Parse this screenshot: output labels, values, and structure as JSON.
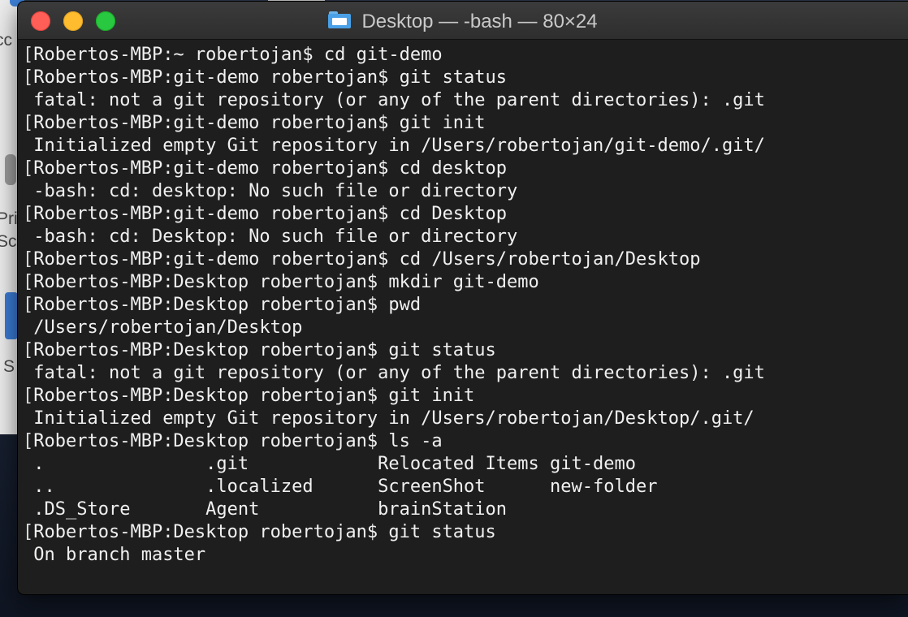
{
  "background": {
    "fragments": [
      "cc",
      "Pri",
      "Sc",
      "S"
    ]
  },
  "window": {
    "title": "Desktop — -bash — 80×24",
    "title_icon": "folder-icon"
  },
  "terminal": {
    "lines": [
      {
        "type": "prompt",
        "text": "Robertos-MBP:~ robertojan$ cd git-demo"
      },
      {
        "type": "prompt",
        "text": "Robertos-MBP:git-demo robertojan$ git status"
      },
      {
        "type": "output",
        "text": "fatal: not a git repository (or any of the parent directories): .git"
      },
      {
        "type": "prompt",
        "text": "Robertos-MBP:git-demo robertojan$ git init"
      },
      {
        "type": "output",
        "text": "Initialized empty Git repository in /Users/robertojan/git-demo/.git/"
      },
      {
        "type": "prompt",
        "text": "Robertos-MBP:git-demo robertojan$ cd desktop"
      },
      {
        "type": "output",
        "text": "-bash: cd: desktop: No such file or directory"
      },
      {
        "type": "prompt",
        "text": "Robertos-MBP:git-demo robertojan$ cd Desktop"
      },
      {
        "type": "output",
        "text": "-bash: cd: Desktop: No such file or directory"
      },
      {
        "type": "prompt",
        "text": "Robertos-MBP:git-demo robertojan$ cd /Users/robertojan/Desktop"
      },
      {
        "type": "prompt",
        "text": "Robertos-MBP:Desktop robertojan$ mkdir git-demo"
      },
      {
        "type": "prompt",
        "text": "Robertos-MBP:Desktop robertojan$ pwd"
      },
      {
        "type": "output",
        "text": "/Users/robertojan/Desktop"
      },
      {
        "type": "prompt",
        "text": "Robertos-MBP:Desktop robertojan$ git status"
      },
      {
        "type": "output",
        "text": "fatal: not a git repository (or any of the parent directories): .git"
      },
      {
        "type": "prompt",
        "text": "Robertos-MBP:Desktop robertojan$ git init"
      },
      {
        "type": "output",
        "text": "Initialized empty Git repository in /Users/robertojan/Desktop/.git/"
      },
      {
        "type": "prompt",
        "text": "Robertos-MBP:Desktop robertojan$ ls -a"
      },
      {
        "type": "output",
        "text": ".               .git            Relocated Items git-demo"
      },
      {
        "type": "output",
        "text": "..              .localized      ScreenShot      new-folder"
      },
      {
        "type": "output",
        "text": ".DS_Store       Agent           brainStation"
      },
      {
        "type": "prompt",
        "text": "Robertos-MBP:Desktop robertojan$ git status"
      },
      {
        "type": "output",
        "text": "On branch master"
      }
    ]
  }
}
